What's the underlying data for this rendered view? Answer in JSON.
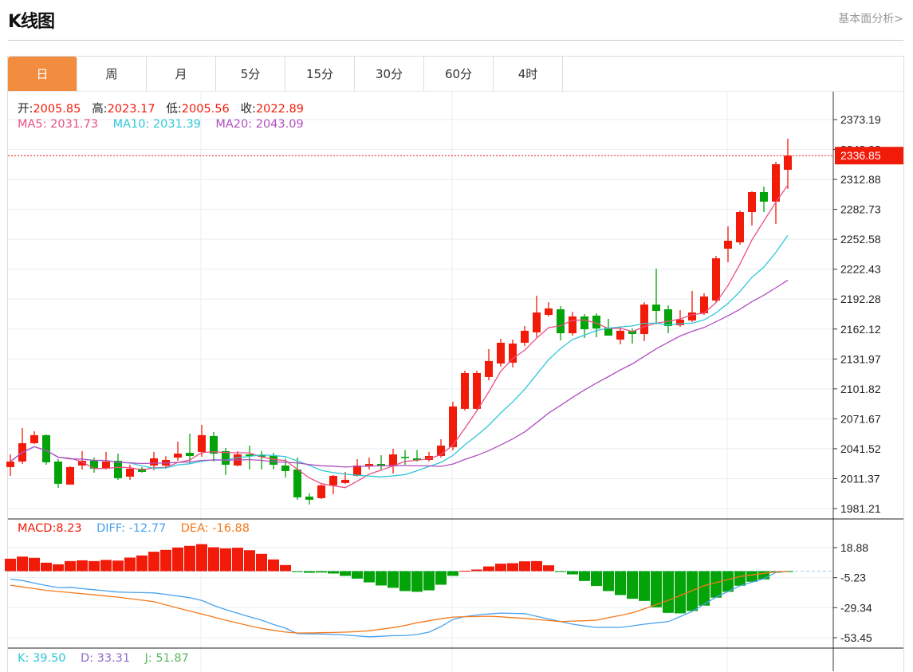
{
  "header": {
    "title": "K线图",
    "link": "基本面分析>"
  },
  "tabs": [
    {
      "label": "日",
      "active": true
    },
    {
      "label": "周"
    },
    {
      "label": "月"
    },
    {
      "label": "5分"
    },
    {
      "label": "15分"
    },
    {
      "label": "30分"
    },
    {
      "label": "60分"
    },
    {
      "label": "4时"
    }
  ],
  "ohlc_info": {
    "open_label": "开:",
    "open": "2005.85",
    "high_label": "高:",
    "high": "2023.17",
    "low_label": "低:",
    "low": "2005.56",
    "close_label": "收:",
    "close": "2022.89"
  },
  "ma_info": {
    "ma5": "MA5: 2031.73",
    "ma10": "MA10: 2031.39",
    "ma20": "MA20: 2043.09"
  },
  "macd_info": {
    "macd": "MACD:8.23",
    "diff": "DIFF: -12.77",
    "dea": "DEA: -16.88"
  },
  "kdj_info": {
    "k": "K: 39.50",
    "d": "D: 33.31",
    "j": "J: 51.87"
  },
  "colors": {
    "up": "#f21b0a",
    "down": "#05a30a",
    "tab_active": "#f28c3f",
    "ma5": "#ec4f86",
    "ma10": "#2ec7d8",
    "ma20": "#b04ec0",
    "diff": "#4aa3f0",
    "dea": "#f47a1c",
    "k": "#2ec7d8",
    "d": "#8e6bc9",
    "j": "#5cb85c"
  },
  "chart_data": [
    {
      "type": "candlestick",
      "ylim": [
        1981.21,
        2373.19
      ],
      "yticks": [
        "2373.19",
        "2343.03",
        "2312.88",
        "2282.73",
        "2252.58",
        "2222.43",
        "2192.28",
        "2162.12",
        "2131.97",
        "2101.82",
        "2071.67",
        "2041.52",
        "2011.37",
        "1981.21"
      ],
      "last_price": "2336.85",
      "moving_averages": [
        "MA5",
        "MA10",
        "MA20"
      ],
      "grid": true,
      "candles": [
        [
          2023.0,
          2035.8,
          2014.2,
          2028.6
        ],
        [
          2028.6,
          2062.4,
          2026.2,
          2047.1
        ],
        [
          2047.1,
          2059.2,
          2046.3,
          2055.2
        ],
        [
          2055.2,
          2055.9,
          2025.4,
          2027.8
        ],
        [
          2028.6,
          2031.0,
          2002.1,
          2006.2
        ],
        [
          2005.4,
          2023.8,
          2005.4,
          2023.0
        ],
        [
          2024.6,
          2039.1,
          2020.6,
          2029.4
        ],
        [
          2029.4,
          2032.6,
          2017.4,
          2021.4
        ],
        [
          2021.4,
          2038.3,
          2020.6,
          2028.6
        ],
        [
          2029.4,
          2036.6,
          2010.2,
          2011.8
        ],
        [
          2013.4,
          2025.4,
          2010.2,
          2021.4
        ],
        [
          2021.4,
          2023.0,
          2017.4,
          2018.2
        ],
        [
          2024.6,
          2038.3,
          2019.8,
          2031.8
        ],
        [
          2024.6,
          2034.0,
          2021.4,
          2030.2
        ],
        [
          2032.6,
          2048.7,
          2029.4,
          2036.6
        ],
        [
          2037.4,
          2056.7,
          2026.2,
          2034.2
        ],
        [
          2038.3,
          2065.6,
          2033.4,
          2055.2
        ],
        [
          2054.4,
          2058.3,
          2028.6,
          2036.6
        ],
        [
          2039.1,
          2042.3,
          2015.0,
          2025.4
        ],
        [
          2024.6,
          2039.1,
          2023.8,
          2035.8
        ],
        [
          2035.8,
          2044.7,
          2020.6,
          2034.2
        ],
        [
          2035.0,
          2039.1,
          2020.6,
          2033.4
        ],
        [
          2034.2,
          2037.4,
          2020.6,
          2025.4
        ],
        [
          2024.6,
          2031.8,
          2012.6,
          2019.0
        ],
        [
          2020.6,
          2032.6,
          1990.1,
          1992.5
        ],
        [
          1993.3,
          1996.5,
          1985.3,
          1990.1
        ],
        [
          1991.7,
          2005.4,
          1990.9,
          2004.6
        ],
        [
          2004.6,
          2015.0,
          1995.7,
          2014.2
        ],
        [
          2007.0,
          2018.2,
          2006.2,
          2010.2
        ],
        [
          2014.2,
          2031.0,
          2013.4,
          2024.6
        ],
        [
          2023.8,
          2032.6,
          2020.6,
          2026.2
        ],
        [
          2026.2,
          2035.0,
          2019.8,
          2024.6
        ],
        [
          2023.8,
          2041.5,
          2016.6,
          2035.8
        ],
        [
          2033.4,
          2040.3,
          2025.4,
          2032.6
        ],
        [
          2031.8,
          2040.3,
          2028.6,
          2030.2
        ],
        [
          2030.2,
          2038.3,
          2028.6,
          2034.2
        ],
        [
          2034.2,
          2051.1,
          2032.6,
          2044.7
        ],
        [
          2043.1,
          2088.9,
          2039.9,
          2084.1
        ],
        [
          2081.7,
          2120.2,
          2080.0,
          2117.8
        ],
        [
          2081.7,
          2120.2,
          2080.9,
          2117.8
        ],
        [
          2113.8,
          2141.9,
          2110.5,
          2129.9
        ],
        [
          2127.4,
          2152.3,
          2124.2,
          2148.3
        ],
        [
          2128.2,
          2151.5,
          2123.4,
          2147.5
        ],
        [
          2148.3,
          2165.2,
          2145.1,
          2160.4
        ],
        [
          2158.8,
          2195.7,
          2153.9,
          2178.8
        ],
        [
          2176.4,
          2189.2,
          2174.8,
          2182.9
        ],
        [
          2182.0,
          2185.2,
          2150.7,
          2157.9
        ],
        [
          2157.9,
          2179.6,
          2155.5,
          2174.8
        ],
        [
          2174.8,
          2177.2,
          2153.1,
          2161.9
        ],
        [
          2175.6,
          2178.0,
          2153.9,
          2162.7
        ],
        [
          2163.5,
          2172.4,
          2155.5,
          2155.5
        ],
        [
          2151.5,
          2164.4,
          2146.7,
          2160.4
        ],
        [
          2160.4,
          2162.7,
          2147.5,
          2157.1
        ],
        [
          2157.1,
          2189.2,
          2149.9,
          2186.8
        ],
        [
          2186.8,
          2223.0,
          2166.8,
          2180.4
        ],
        [
          2182.0,
          2186.0,
          2157.9,
          2165.2
        ],
        [
          2166.0,
          2181.2,
          2164.4,
          2171.6
        ],
        [
          2170.8,
          2200.5,
          2169.2,
          2178.8
        ],
        [
          2178.0,
          2198.1,
          2176.4,
          2194.9
        ],
        [
          2190.9,
          2235.8,
          2188.5,
          2233.4
        ],
        [
          2243.1,
          2265.6,
          2229.4,
          2251.1
        ],
        [
          2249.5,
          2281.6,
          2247.1,
          2280.0
        ],
        [
          2280.0,
          2300.9,
          2266.4,
          2300.1
        ],
        [
          2300.1,
          2305.7,
          2280.0,
          2290.5
        ],
        [
          2290.5,
          2330.6,
          2268.0,
          2328.2
        ],
        [
          2322.6,
          2353.9,
          2303.3,
          2336.85
        ]
      ]
    },
    {
      "type": "macd",
      "ylim": [
        -62.0,
        27.5
      ],
      "yticks": [
        "18.88",
        "-5.23",
        "-29.34",
        "-53.45"
      ],
      "histogram": [
        10.0,
        11.7,
        10.7,
        6.8,
        5.5,
        8.1,
        8.7,
        8.1,
        9.0,
        8.5,
        10.9,
        12.6,
        15.6,
        17.1,
        19.0,
        20.3,
        21.7,
        19.2,
        18.3,
        18.8,
        16.8,
        13.9,
        9.4,
        4.9,
        -0.2,
        -1.3,
        -1.1,
        -1.9,
        -3.8,
        -6.0,
        -9.0,
        -11.5,
        -13.4,
        -16.0,
        -16.6,
        -15.4,
        -10.9,
        -3.8,
        0.3,
        1.3,
        3.8,
        6.0,
        6.4,
        7.9,
        8.1,
        4.7,
        -0.4,
        -2.6,
        -7.9,
        -11.9,
        -16.0,
        -19.2,
        -22.2,
        -23.9,
        -29.0,
        -33.5,
        -33.9,
        -32.0,
        -27.7,
        -21.3,
        -16.6,
        -11.7,
        -8.5,
        -6.6,
        -1.3,
        -0.3
      ],
      "diff": [
        -6.4,
        -7.5,
        -9.6,
        -11.5,
        -13.2,
        -13.0,
        -14.0,
        -14.9,
        -15.8,
        -16.8,
        -17.0,
        -17.2,
        -17.5,
        -18.6,
        -20.0,
        -21.3,
        -23.5,
        -27.5,
        -30.9,
        -33.8,
        -36.6,
        -39.4,
        -42.8,
        -45.8,
        -50.1,
        -50.3,
        -50.5,
        -50.7,
        -51.3,
        -52.0,
        -52.7,
        -52.3,
        -51.8,
        -51.8,
        -50.8,
        -49.0,
        -44.5,
        -38.8,
        -36.5,
        -35.2,
        -34.4,
        -33.7,
        -33.9,
        -34.1,
        -36.2,
        -38.4,
        -40.5,
        -42.6,
        -44.0,
        -45.2,
        -45.2,
        -45.2,
        -43.9,
        -42.6,
        -41.5,
        -40.5,
        -36.5,
        -32.4,
        -26.6,
        -20.9,
        -16.3,
        -11.7,
        -8.9,
        -6.0,
        -1.1,
        0
      ],
      "dea": [
        -11.3,
        -12.7,
        -14.0,
        -15.4,
        -16.3,
        -17.2,
        -18.1,
        -19.0,
        -20.0,
        -20.9,
        -22.1,
        -23.3,
        -24.5,
        -27.0,
        -29.6,
        -32.0,
        -34.4,
        -36.9,
        -39.4,
        -41.6,
        -43.9,
        -45.9,
        -47.5,
        -48.9,
        -49.7,
        -49.6,
        -49.4,
        -49.2,
        -49.0,
        -48.5,
        -47.9,
        -46.6,
        -45.3,
        -43.6,
        -41.5,
        -39.8,
        -38.2,
        -36.9,
        -36.6,
        -36.4,
        -36.2,
        -36.7,
        -37.3,
        -37.9,
        -38.8,
        -39.6,
        -40.5,
        -40.1,
        -39.8,
        -39.4,
        -37.4,
        -35.5,
        -33.5,
        -30.2,
        -26.8,
        -23.5,
        -19.6,
        -15.6,
        -11.7,
        -9.2,
        -6.7,
        -4.3,
        -3.0,
        -1.8,
        -0.6,
        0
      ]
    }
  ]
}
